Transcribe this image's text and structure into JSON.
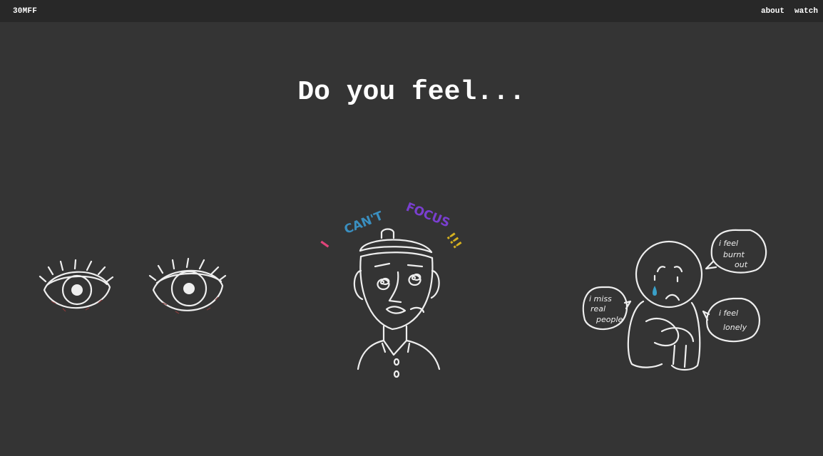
{
  "colors": {
    "background": "#343434",
    "topbar": "#282828",
    "chalk": "#eeeeee",
    "tear": "#3aa0c8"
  },
  "header": {
    "brand": "30MFF",
    "nav": [
      {
        "label": "about"
      },
      {
        "label": "watch"
      }
    ]
  },
  "hero": {
    "headline": "Do you feel..."
  },
  "illustrations": {
    "eyes": {
      "icon": "tired-eyes-drawing"
    },
    "focus": {
      "icon": "distracted-person-drawing",
      "caption_words": [
        {
          "text": "I",
          "color": "#e0447a"
        },
        {
          "text": "CAN'T",
          "color": "#3a8fc0"
        },
        {
          "text": "FOCUS",
          "color": "#7a3fd0"
        },
        {
          "text": "!!!",
          "color": "#d6b21f"
        }
      ]
    },
    "sad": {
      "icon": "sad-person-drawing",
      "bubbles": [
        {
          "lines": [
            "i miss",
            "real",
            "people"
          ]
        },
        {
          "lines": [
            "i feel",
            "burnt",
            "out"
          ]
        },
        {
          "lines": [
            "i feel",
            "lonely"
          ]
        }
      ]
    }
  }
}
